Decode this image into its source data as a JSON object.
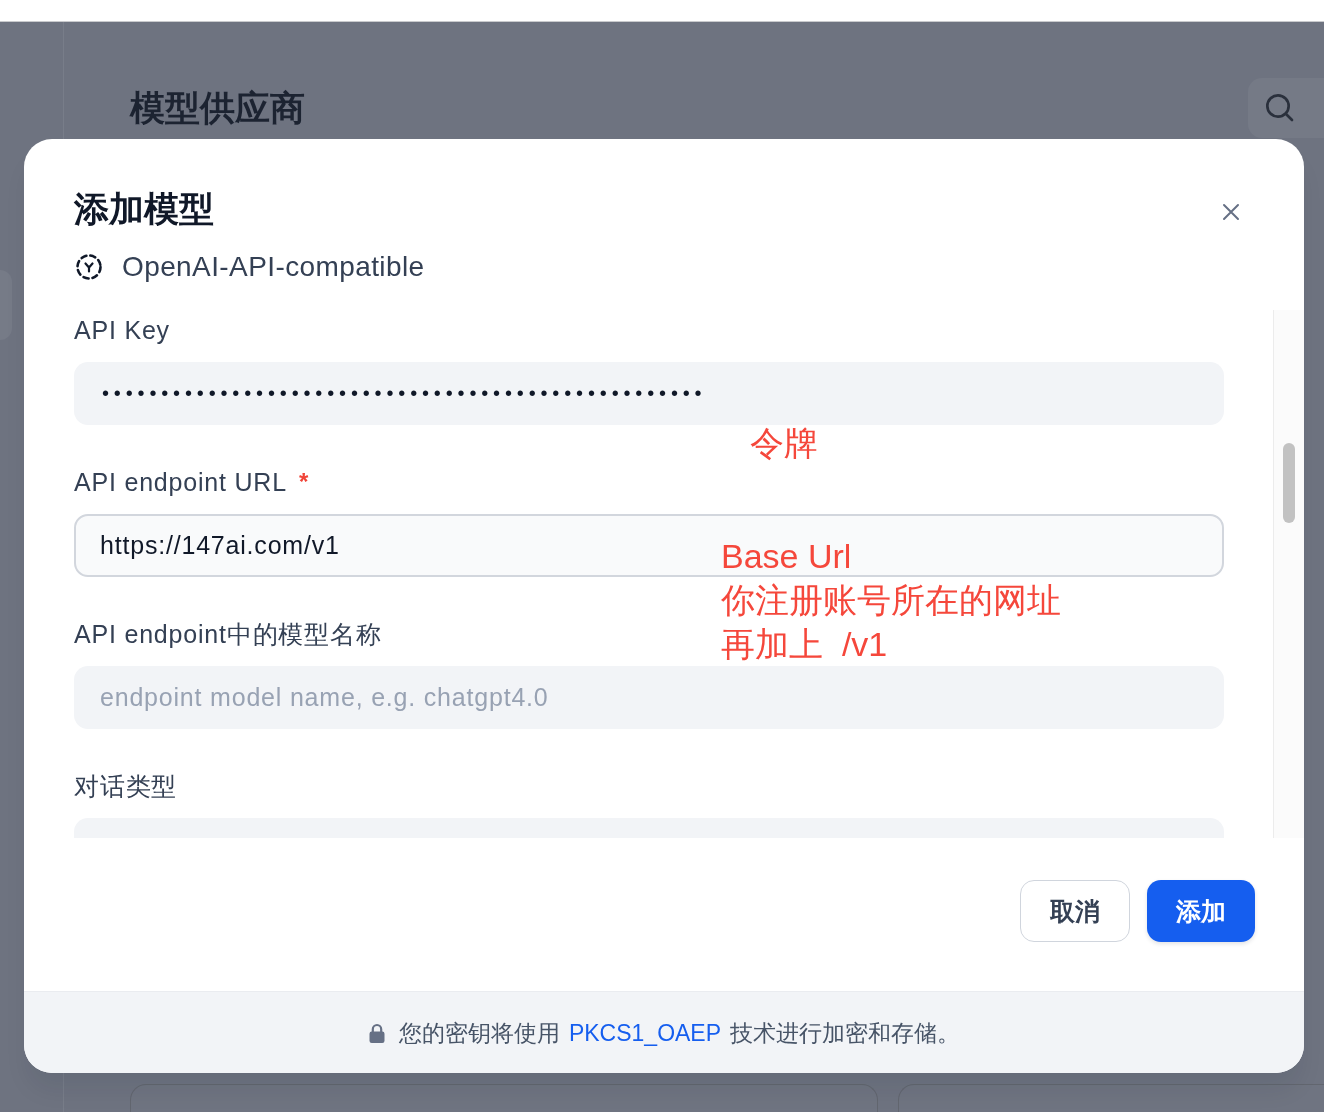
{
  "background": {
    "heading": "模型供应商"
  },
  "dialog": {
    "title": "添加模型",
    "provider": "OpenAI-API-compatible",
    "fields": [
      {
        "kind": "password",
        "label": "API Key",
        "value": "•••••••••••••••••••••••••••••••••••••••••••••••••••",
        "focused": false
      },
      {
        "kind": "text",
        "label": "API endpoint URL",
        "required_mark": "*",
        "value": "https://147ai.com/v1",
        "focused": true
      },
      {
        "kind": "text",
        "label": "API endpoint中的模型名称",
        "placeholder": "endpoint model name, e.g. chatgpt4.0",
        "focused": false
      },
      {
        "kind": "select",
        "label": "对话类型",
        "focused": false
      }
    ],
    "buttons": [
      {
        "kind": "secondary",
        "label": "取消"
      },
      {
        "kind": "primary",
        "label": "添加"
      }
    ],
    "notice": {
      "text_before": "您的密钥将使用",
      "link": "PKCS1_OAEP",
      "text_after": "技术进行加密和存储。"
    }
  },
  "annotations": [
    {
      "lines": [
        "令牌"
      ]
    },
    {
      "lines": [
        "Base Url",
        "你注册账号所在的网址",
        "再加上  /v1"
      ]
    }
  ]
}
